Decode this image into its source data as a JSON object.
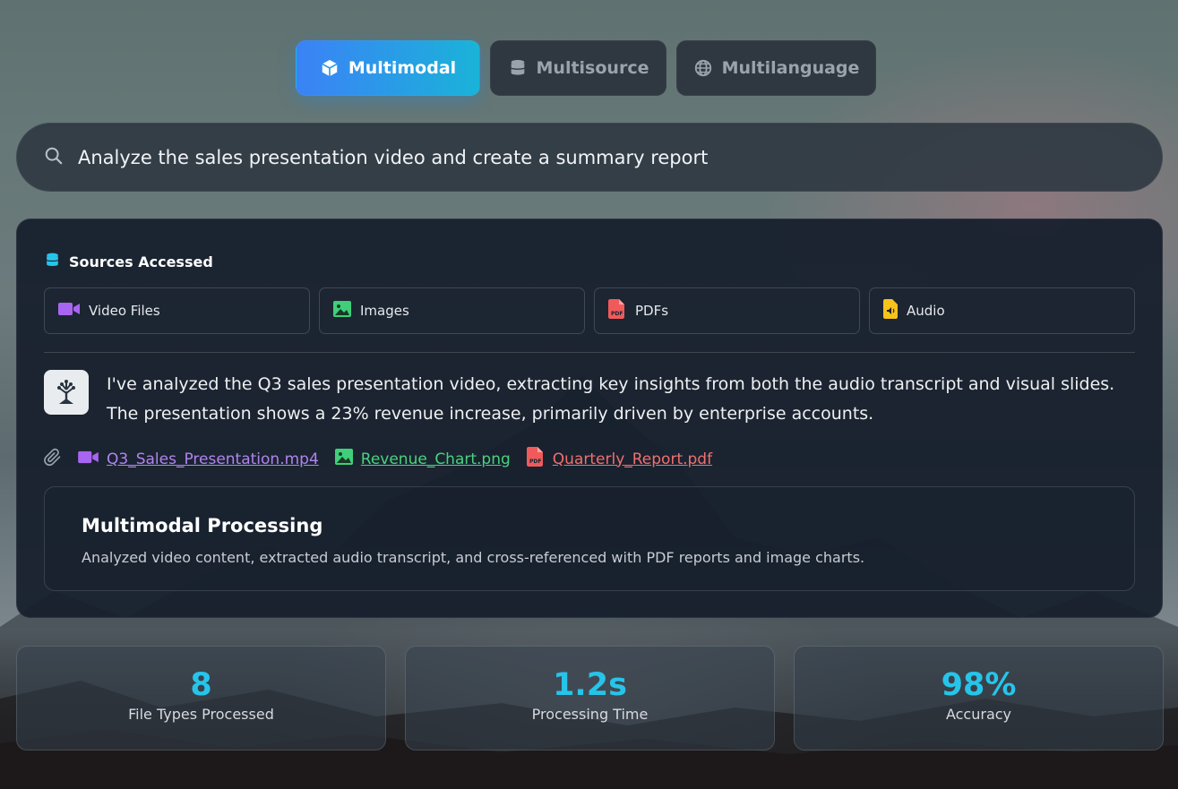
{
  "tabs": [
    {
      "label": "Multimodal",
      "icon": "cube-icon",
      "active": true
    },
    {
      "label": "Multisource",
      "icon": "database-icon",
      "active": false
    },
    {
      "label": "Multilanguage",
      "icon": "globe-icon",
      "active": false
    }
  ],
  "search": {
    "query": "Analyze the sales presentation video and create a summary report",
    "icon": "search-icon"
  },
  "sources": {
    "title": "Sources Accessed",
    "items": [
      {
        "label": "Video Files",
        "icon": "video-icon",
        "color": "#a865f0"
      },
      {
        "label": "Images",
        "icon": "image-icon",
        "color": "#3fcf7a"
      },
      {
        "label": "PDFs",
        "icon": "pdf-icon",
        "color": "#f05a5a"
      },
      {
        "label": "Audio",
        "icon": "audio-file-icon",
        "color": "#f7c21b"
      }
    ]
  },
  "reply": {
    "text": "I've analyzed the Q3 sales presentation video, extracting key insights from both the audio transcript and visual slides. The presentation shows a 23% revenue increase, primarily driven by enterprise accounts."
  },
  "attachments": [
    {
      "name": "Q3_Sales_Presentation.mp4",
      "icon": "video-icon",
      "color": "#b184ef"
    },
    {
      "name": "Revenue_Chart.png",
      "icon": "image-icon",
      "color": "#4ad27f"
    },
    {
      "name": "Quarterly_Report.pdf",
      "icon": "pdf-icon",
      "color": "#f07070"
    }
  ],
  "processing": {
    "title": "Multimodal Processing",
    "description": "Analyzed video content, extracted audio transcript, and cross-referenced with PDF reports and image charts."
  },
  "stats": [
    {
      "value": "8",
      "label": "File Types Processed"
    },
    {
      "value": "1.2s",
      "label": "Processing Time"
    },
    {
      "value": "98%",
      "label": "Accuracy"
    }
  ],
  "colors": {
    "accent": "#27c4ea",
    "tab_gradient_start": "#3b82f6",
    "tab_gradient_end": "#1ab3d8"
  }
}
